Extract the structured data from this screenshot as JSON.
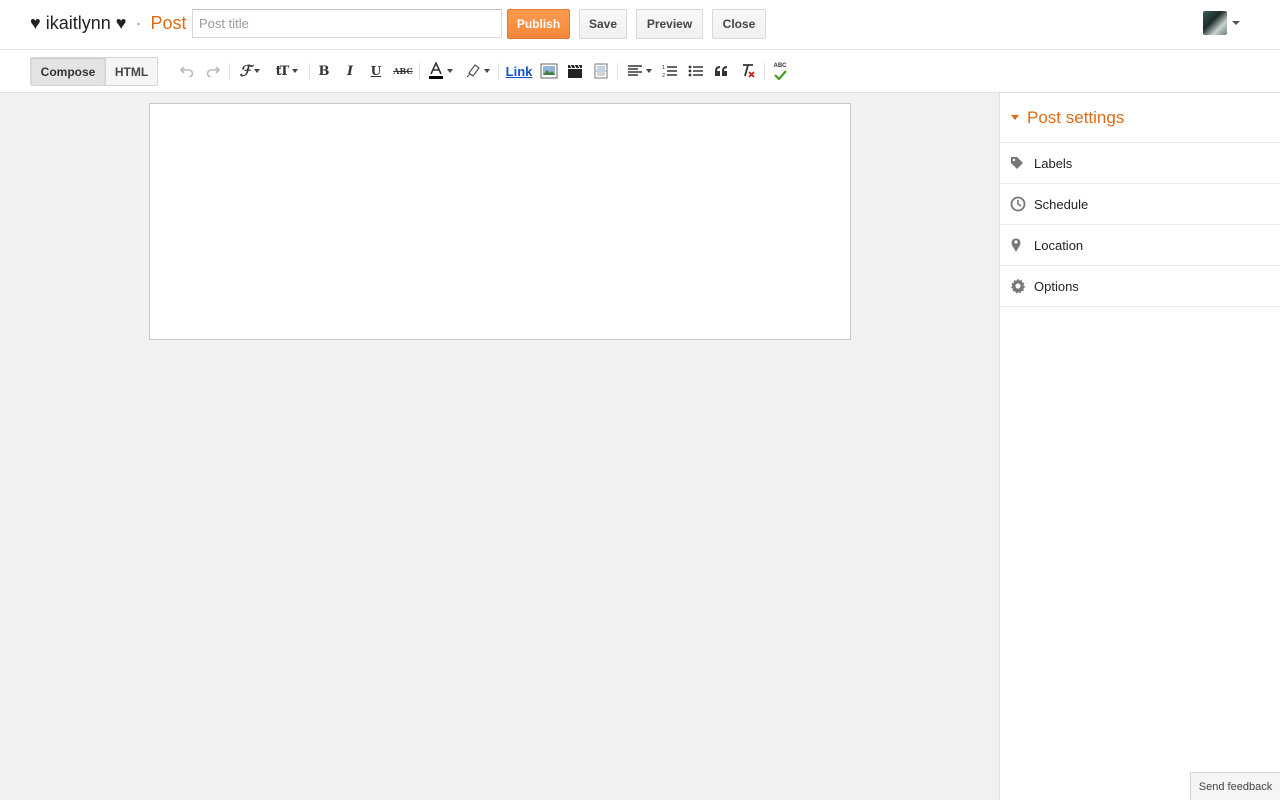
{
  "header": {
    "blog_name": "♥ ikaitlynn ♥",
    "separator": "·",
    "page_label": "Post",
    "title_placeholder": "Post title",
    "title_value": "",
    "publish_label": "Publish",
    "save_label": "Save",
    "preview_label": "Preview",
    "close_label": "Close"
  },
  "toolbar": {
    "compose_label": "Compose",
    "html_label": "HTML",
    "link_label": "Link",
    "icons": [
      "undo-icon",
      "redo-icon",
      "font-family-icon",
      "font-size-icon",
      "bold-icon",
      "italic-icon",
      "underline-icon",
      "strikethrough-icon",
      "text-color-icon",
      "highlight-color-icon",
      "link",
      "insert-image-icon",
      "insert-video-icon",
      "jump-break-icon",
      "alignment-icon",
      "numbered-list-icon",
      "bullet-list-icon",
      "quote-icon",
      "remove-formatting-icon",
      "spellcheck-icon"
    ],
    "spellcheck_text": "ABC",
    "strike_text": "ABC",
    "bold_text": "B",
    "italic_text": "I",
    "underline_text": "U"
  },
  "sidebar": {
    "title": "Post settings",
    "items": [
      {
        "label": "Labels",
        "icon": "tag-icon"
      },
      {
        "label": "Schedule",
        "icon": "clock-icon"
      },
      {
        "label": "Location",
        "icon": "map-pin-icon"
      },
      {
        "label": "Options",
        "icon": "gear-icon"
      }
    ]
  },
  "footer": {
    "feedback_label": "Send feedback"
  },
  "colors": {
    "accent": "#dd6b16",
    "publish": "#f6873c",
    "background": "#f1f1f1"
  }
}
